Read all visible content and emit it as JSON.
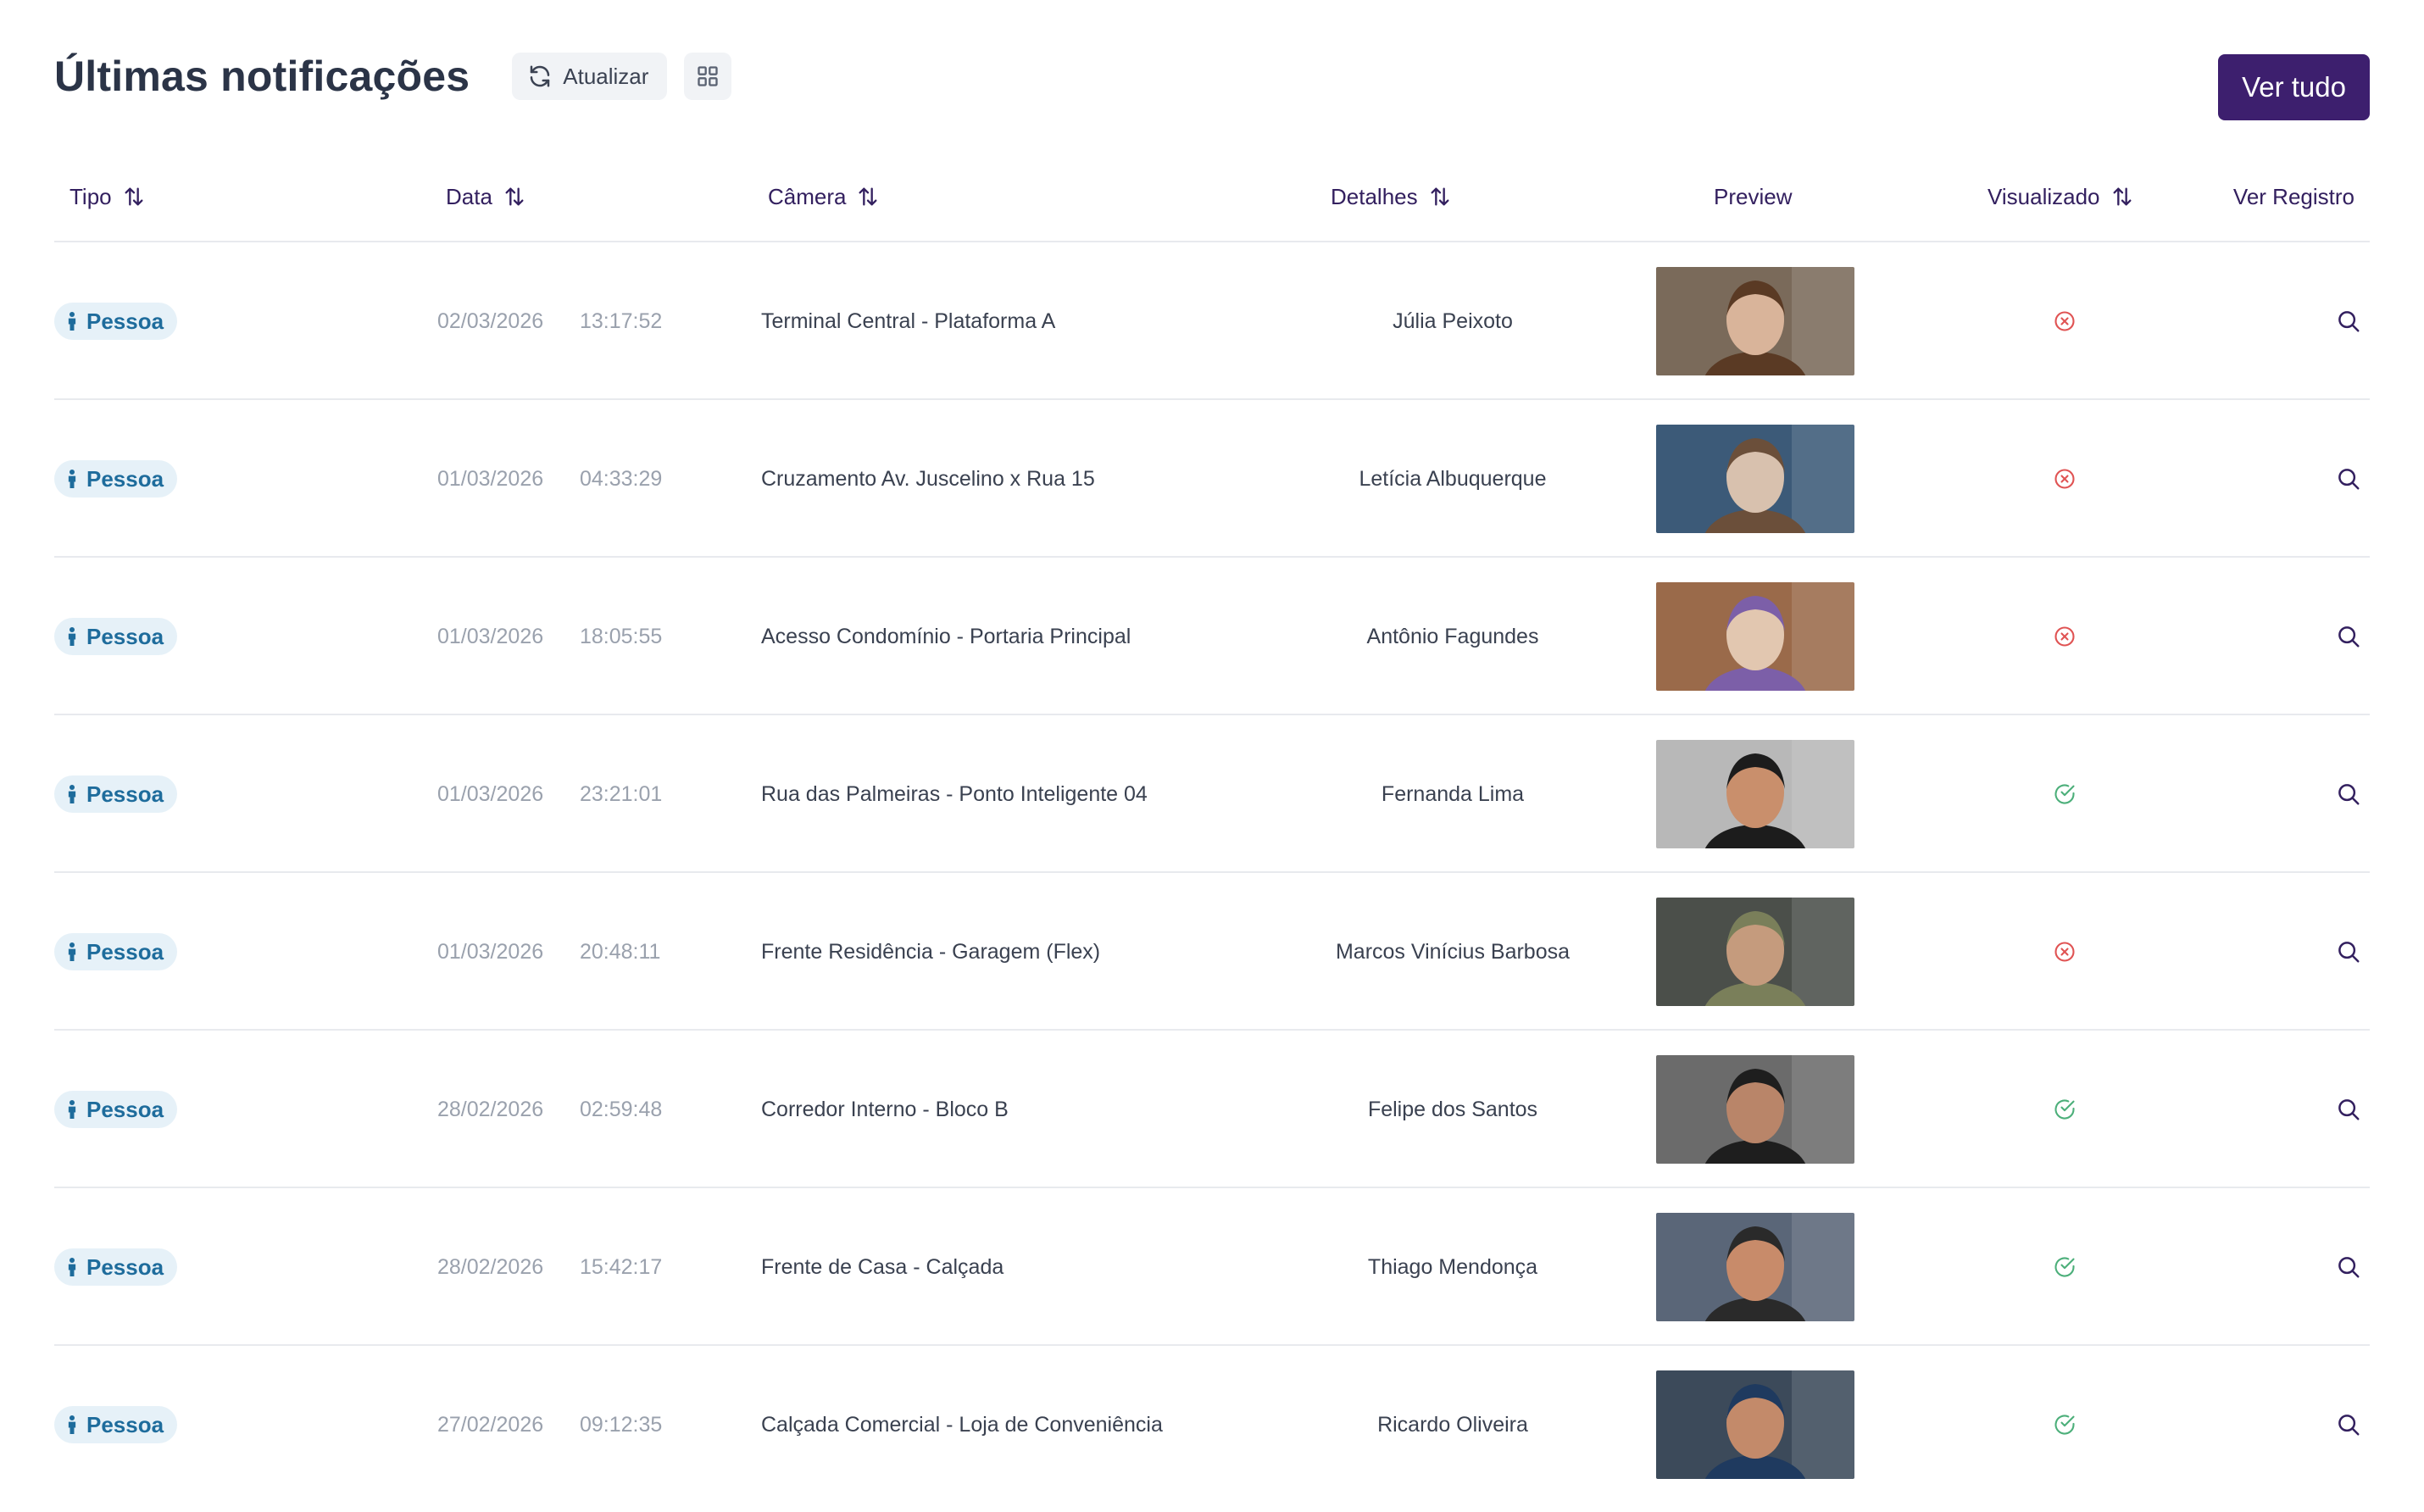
{
  "header": {
    "title": "Últimas notificações",
    "refresh_label": "Atualizar",
    "view_all_label": "Ver tudo"
  },
  "colors": {
    "primary": "#3d1f6e",
    "badge_bg": "#e6f1f8",
    "badge_text": "#1e6c9c",
    "status_not_viewed": "#e05353",
    "status_viewed": "#4caf7a"
  },
  "table": {
    "columns": {
      "tipo": "Tipo",
      "data": "Data",
      "camera": "Câmera",
      "detalhes": "Detalhes",
      "preview": "Preview",
      "visualizado": "Visualizado",
      "ver_registro": "Ver Registro"
    },
    "rows": [
      {
        "tipo": "Pessoa",
        "date": "02/03/2026",
        "time": "13:17:52",
        "camera": "Terminal Central - Plataforma A",
        "details": "Júlia Peixoto",
        "viewed": false
      },
      {
        "tipo": "Pessoa",
        "date": "01/03/2026",
        "time": "04:33:29",
        "camera": "Cruzamento Av. Juscelino x Rua 15",
        "details": "Letícia Albuquerque",
        "viewed": false
      },
      {
        "tipo": "Pessoa",
        "date": "01/03/2026",
        "time": "18:05:55",
        "camera": "Acesso Condomínio - Portaria Principal",
        "details": "Antônio Fagundes",
        "viewed": false
      },
      {
        "tipo": "Pessoa",
        "date": "01/03/2026",
        "time": "23:21:01",
        "camera": "Rua das Palmeiras - Ponto Inteligente 04",
        "details": "Fernanda Lima",
        "viewed": true
      },
      {
        "tipo": "Pessoa",
        "date": "01/03/2026",
        "time": "20:48:11",
        "camera": "Frente Residência - Garagem (Flex)",
        "details": "Marcos Vinícius Barbosa",
        "viewed": false
      },
      {
        "tipo": "Pessoa",
        "date": "28/02/2026",
        "time": "02:59:48",
        "camera": "Corredor Interno - Bloco B",
        "details": "Felipe dos Santos",
        "viewed": true
      },
      {
        "tipo": "Pessoa",
        "date": "28/02/2026",
        "time": "15:42:17",
        "camera": "Frente de Casa - Calçada",
        "details": "Thiago Mendonça",
        "viewed": true
      },
      {
        "tipo": "Pessoa",
        "date": "27/02/2026",
        "time": "09:12:35",
        "camera": "Calçada Comercial - Loja de Conveniência",
        "details": "Ricardo Oliveira",
        "viewed": true
      }
    ]
  }
}
